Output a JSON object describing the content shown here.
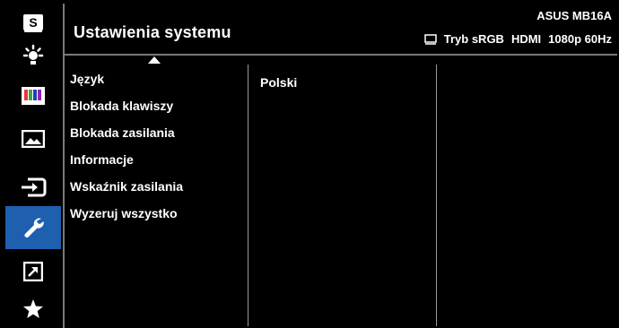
{
  "header": {
    "title": "Ustawienia systemu",
    "model": "ASUS MB16A",
    "mode": "Tryb sRGB",
    "input": "HDMI",
    "resolution": "1080p 60Hz"
  },
  "sidebar": {
    "items": [
      {
        "icon": "splendid-icon",
        "label": "S"
      },
      {
        "icon": "brightness-icon"
      },
      {
        "icon": "color-icon"
      },
      {
        "icon": "image-icon"
      },
      {
        "icon": "input-select-icon"
      },
      {
        "icon": "wrench-icon",
        "active": true
      },
      {
        "icon": "shortcut-icon"
      },
      {
        "icon": "favorite-star-icon"
      }
    ]
  },
  "menu": {
    "items": [
      "Język",
      "Blokada klawiszy",
      "Blokada zasilania",
      "Informacje",
      "Wskaźnik zasilania",
      "Wyzeruj wszystko"
    ]
  },
  "submenu": {
    "value": "Polski"
  },
  "colors": {
    "accent": "#1f5fb0",
    "background": "#000000",
    "text": "#ffffff"
  }
}
